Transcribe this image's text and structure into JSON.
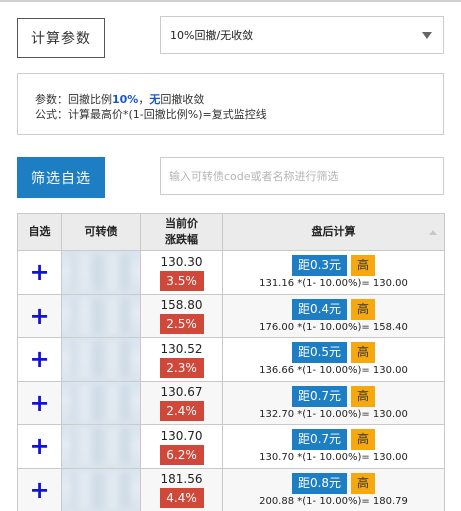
{
  "params_button": "计算参数",
  "select": {
    "value": "10%回撤/无收敛"
  },
  "info": {
    "line1_prefix": "参数：回撤比例",
    "line1_pct": "10%",
    "line1_sep": "，",
    "line1_no": "无",
    "line1_suffix": "回撤收敛",
    "line2": "公式：计算最高价*(1-回撤比例%)=复式监控线"
  },
  "filter_button": "筛选自选",
  "search": {
    "placeholder": "输入可转债code或者名称进行筛选"
  },
  "table": {
    "headers": {
      "select": "自选",
      "bond": "可转债",
      "price_line1": "当前价",
      "price_line2": "涨跌幅",
      "calc": "盘后计算"
    },
    "rows": [
      {
        "add": "+",
        "price": "130.30",
        "change": "3.5%",
        "distance": "距0.3元",
        "level": "高",
        "formula": "131.16 *(1- 10.00%)= 130.00"
      },
      {
        "add": "+",
        "price": "158.80",
        "change": "2.5%",
        "distance": "距0.4元",
        "level": "高",
        "formula": "176.00 *(1- 10.00%)= 158.40"
      },
      {
        "add": "+",
        "price": "130.52",
        "change": "2.3%",
        "distance": "距0.5元",
        "level": "高",
        "formula": "136.66 *(1- 10.00%)= 130.00"
      },
      {
        "add": "+",
        "price": "130.67",
        "change": "2.4%",
        "distance": "距0.7元",
        "level": "高",
        "formula": "132.70 *(1- 10.00%)= 130.00"
      },
      {
        "add": "+",
        "price": "130.70",
        "change": "6.2%",
        "distance": "距0.7元",
        "level": "高",
        "formula": "130.70 *(1- 10.00%)= 130.00"
      },
      {
        "add": "+",
        "price": "181.56",
        "change": "4.4%",
        "distance": "距0.8元",
        "level": "高",
        "formula": "200.88 *(1- 10.00%)= 180.79"
      }
    ]
  },
  "colors": {
    "primary_blue": "#1e7ec4",
    "change_red": "#d0483a",
    "level_orange": "#f6a80f",
    "plus_blue": "#1313d8"
  }
}
